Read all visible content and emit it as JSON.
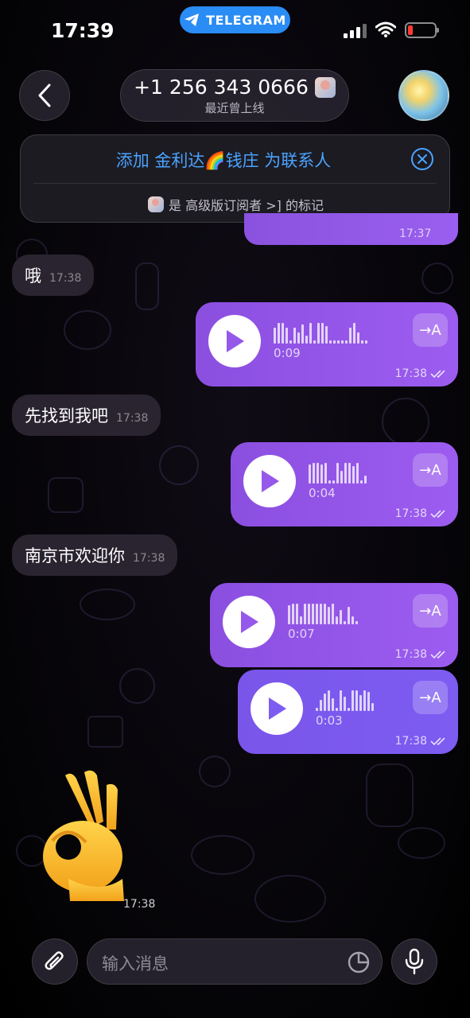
{
  "status": {
    "time": "17:39",
    "app_pill": "TELEGRAM"
  },
  "header": {
    "contact": "+1 256 343 0666",
    "last_seen": "最近曾上线"
  },
  "banner": {
    "add_contact": "添加 金利达🌈钱庄 为联系人",
    "premium_note": "是 高级版订阅者 >] 的标记"
  },
  "peek_time": "17:37",
  "messages": [
    {
      "type": "text",
      "dir": "in",
      "text": "哦",
      "time": "17:38"
    },
    {
      "type": "voice",
      "dir": "out",
      "duration": "0:09",
      "time": "17:38",
      "translate": "→A"
    },
    {
      "type": "text",
      "dir": "in",
      "text": "先找到我吧",
      "time": "17:38"
    },
    {
      "type": "voice",
      "dir": "out",
      "duration": "0:04",
      "time": "17:38",
      "translate": "→A"
    },
    {
      "type": "text",
      "dir": "in",
      "text": "南京市欢迎你",
      "time": "17:38"
    },
    {
      "type": "voice",
      "dir": "out",
      "duration": "0:07",
      "time": "17:38",
      "translate": "→A"
    },
    {
      "type": "voice",
      "dir": "out",
      "duration": "0:03",
      "time": "17:38",
      "translate": "→A"
    },
    {
      "type": "emoji",
      "dir": "in",
      "emoji": "ok-hand",
      "time": "17:38"
    }
  ],
  "composer": {
    "placeholder": "输入消息"
  },
  "colors": {
    "accent": "#4aa3ff",
    "bubble_out": "#9558ea",
    "bubble_in": "#2a2430",
    "pill": "#2a8cf5"
  }
}
